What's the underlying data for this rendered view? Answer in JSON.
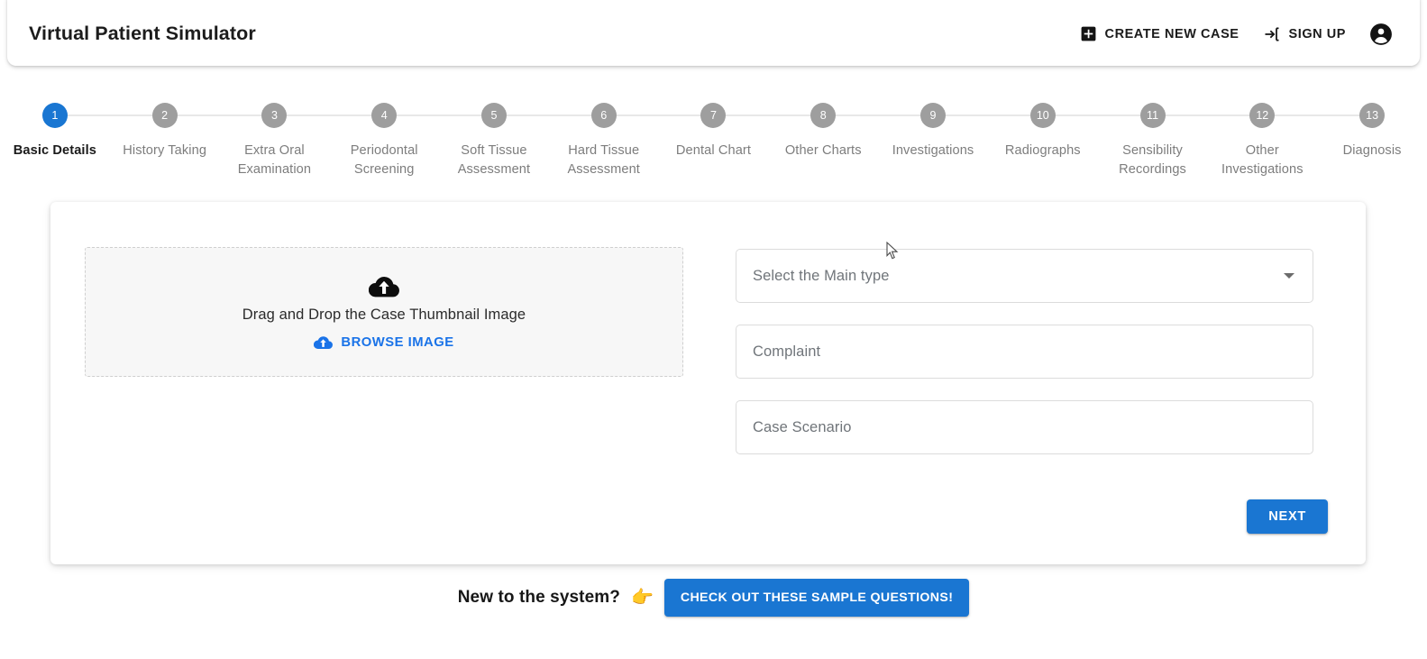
{
  "header": {
    "title": "Virtual Patient Simulator",
    "actions": [
      {
        "label": "CREATE NEW CASE",
        "icon": "add-box-icon"
      },
      {
        "label": "SIGN UP",
        "icon": "login-icon"
      }
    ],
    "avatar_icon": "account-circle-icon"
  },
  "stepper": {
    "active_index": 0,
    "steps": [
      {
        "number": "1",
        "label": "Basic Details"
      },
      {
        "number": "2",
        "label": "History Taking"
      },
      {
        "number": "3",
        "label": "Extra Oral Examination"
      },
      {
        "number": "4",
        "label": "Periodontal Screening"
      },
      {
        "number": "5",
        "label": "Soft Tissue Assessment"
      },
      {
        "number": "6",
        "label": "Hard Tissue Assessment"
      },
      {
        "number": "7",
        "label": "Dental Chart"
      },
      {
        "number": "8",
        "label": "Other Charts"
      },
      {
        "number": "9",
        "label": "Investigations"
      },
      {
        "number": "10",
        "label": "Radiographs"
      },
      {
        "number": "11",
        "label": "Sensibility Recordings"
      },
      {
        "number": "12",
        "label": "Other Investigations"
      },
      {
        "number": "13",
        "label": "Diagnosis"
      }
    ]
  },
  "upload": {
    "drop_text": "Drag and Drop the Case Thumbnail Image",
    "browse_label": "BROWSE IMAGE",
    "cloud_icon": "cloud-upload-icon",
    "browse_icon": "cloud-upload-icon"
  },
  "form": {
    "main_type": {
      "placeholder": "Select the Main type",
      "value": ""
    },
    "complaint": {
      "placeholder": "Complaint",
      "value": ""
    },
    "case_scenario": {
      "placeholder": "Case Scenario",
      "value": ""
    },
    "next_label": "NEXT"
  },
  "footer": {
    "prompt": "New to the system?",
    "emoji": "👉",
    "button_label": "CHECK OUT THESE SAMPLE QUESTIONS!"
  },
  "colors": {
    "accent_blue": "#1976d2",
    "button_blue": "#1a76d2",
    "link_blue": "#1a73e8",
    "step_inactive": "#9e9e9e",
    "connector": "#e8e8e8",
    "dropzone_bg": "#f7f7f7"
  }
}
